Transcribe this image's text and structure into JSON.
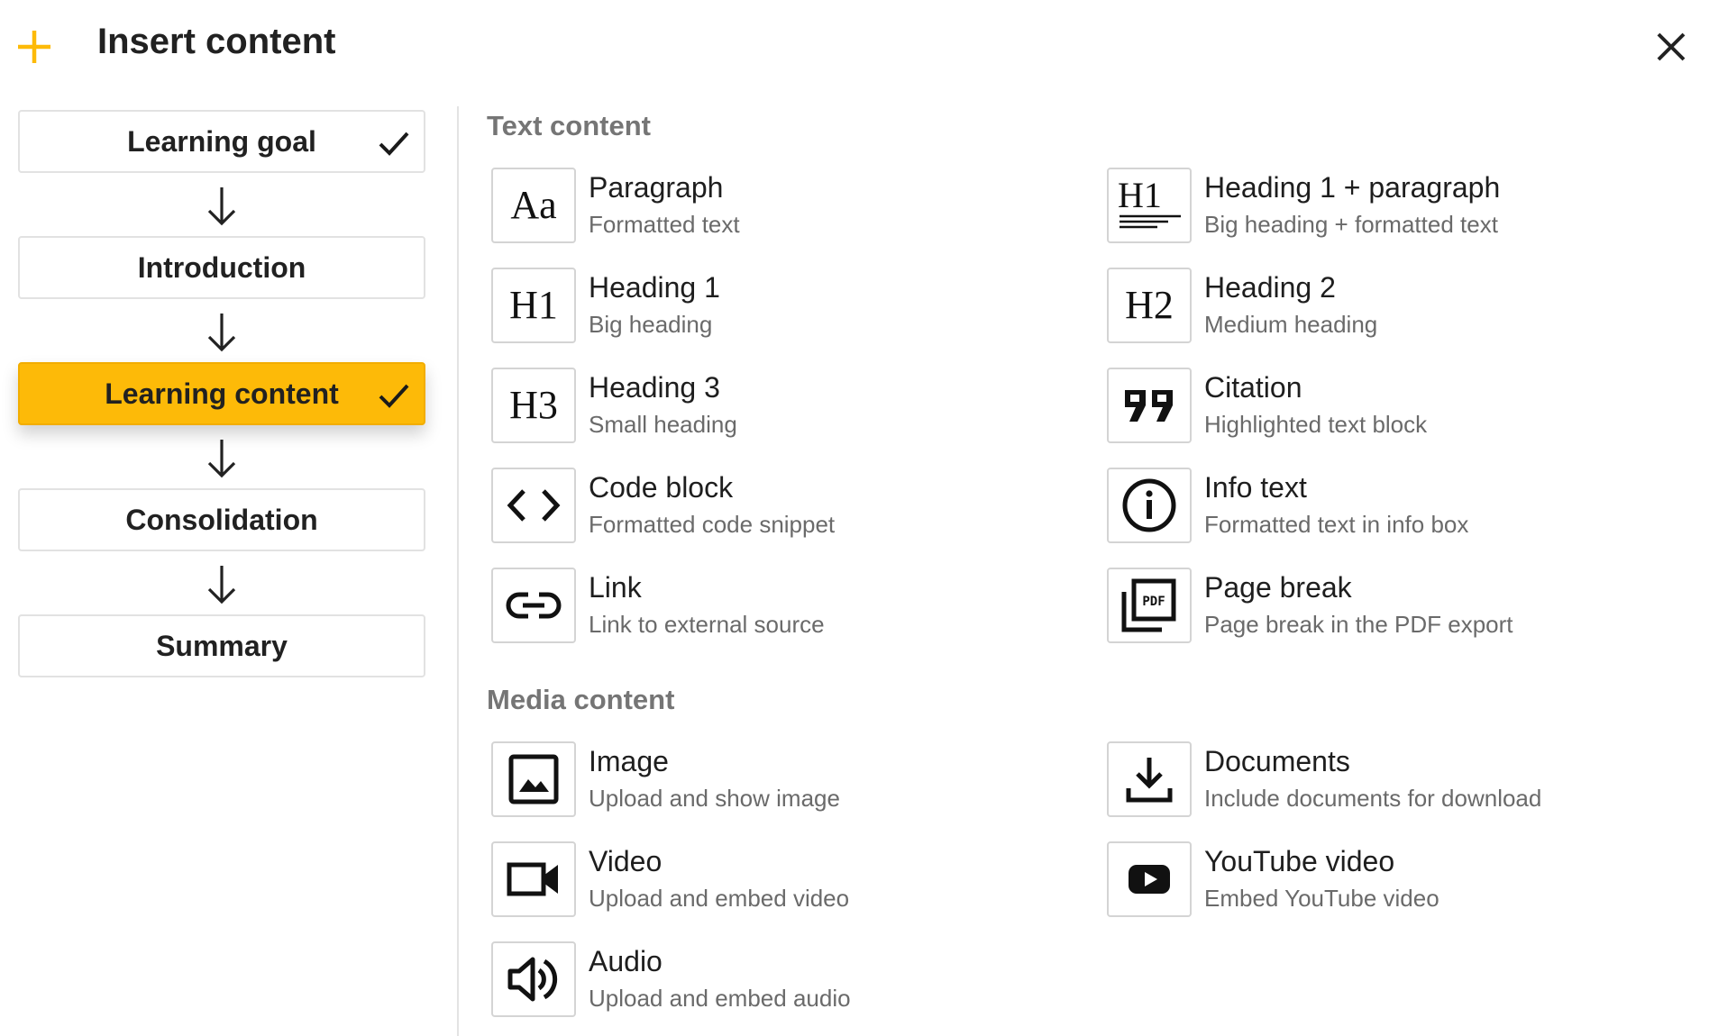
{
  "header": {
    "title": "Insert content",
    "accent": "#fdba08"
  },
  "steps": [
    {
      "label": "Learning goal",
      "checked": true,
      "active": false
    },
    {
      "label": "Introduction",
      "checked": false,
      "active": false
    },
    {
      "label": "Learning content",
      "checked": true,
      "active": true
    },
    {
      "label": "Consolidation",
      "checked": false,
      "active": false
    },
    {
      "label": "Summary",
      "checked": false,
      "active": false
    }
  ],
  "sections": {
    "text": {
      "title": "Text content",
      "items": [
        {
          "title": "Paragraph",
          "subtitle": "Formatted text",
          "icon": "aa-glyph",
          "glyph": "Aa"
        },
        {
          "title": "Heading 1 + paragraph",
          "subtitle": "Big heading + formatted text",
          "icon": "h1-paragraph-icon",
          "glyph": "H1"
        },
        {
          "title": "Heading 1",
          "subtitle": "Big heading",
          "icon": "h1-glyph",
          "glyph": "H1"
        },
        {
          "title": "Heading 2",
          "subtitle": "Medium heading",
          "icon": "h2-glyph",
          "glyph": "H2"
        },
        {
          "title": "Heading 3",
          "subtitle": "Small heading",
          "icon": "h3-glyph",
          "glyph": "H3"
        },
        {
          "title": "Citation",
          "subtitle": "Highlighted text block",
          "icon": "quote-icon"
        },
        {
          "title": "Code block",
          "subtitle": "Formatted code snippet",
          "icon": "code-icon"
        },
        {
          "title": "Info text",
          "subtitle": "Formatted text in info box",
          "icon": "info-icon"
        },
        {
          "title": "Link",
          "subtitle": "Link to external source",
          "icon": "link-icon"
        },
        {
          "title": "Page break",
          "subtitle": "Page break in the PDF export",
          "icon": "pdf-icon",
          "glyph": "PDF"
        }
      ]
    },
    "media": {
      "title": "Media content",
      "items": [
        {
          "title": "Image",
          "subtitle": "Upload and show image",
          "icon": "image-icon"
        },
        {
          "title": "Documents",
          "subtitle": "Include documents for download",
          "icon": "download-icon"
        },
        {
          "title": "Video",
          "subtitle": "Upload and embed video",
          "icon": "video-icon"
        },
        {
          "title": "YouTube video",
          "subtitle": "Embed YouTube video",
          "icon": "youtube-icon"
        },
        {
          "title": "Audio",
          "subtitle": "Upload and embed audio",
          "icon": "audio-icon"
        }
      ]
    }
  }
}
